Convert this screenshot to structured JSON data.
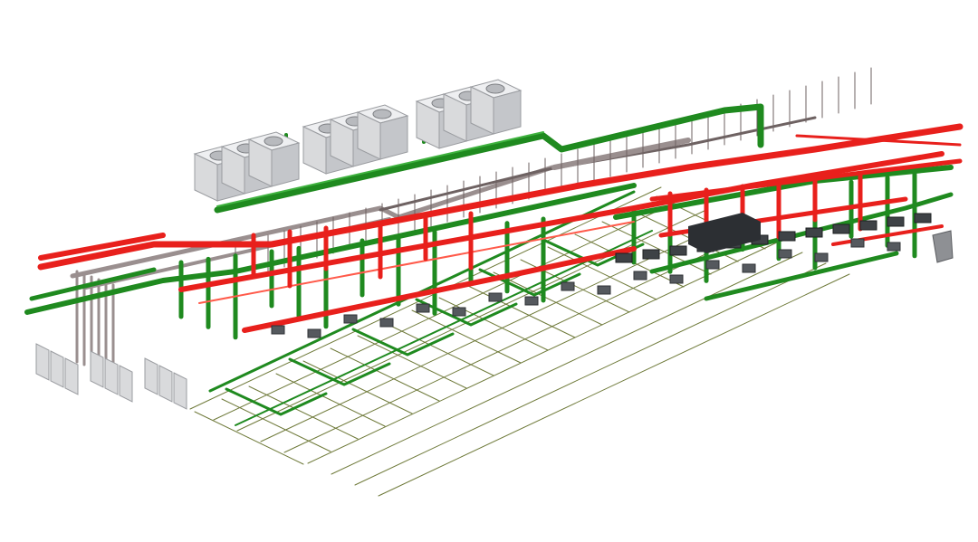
{
  "scene": {
    "kind": "isometric MEP piping model",
    "background_color": "#ffffff",
    "colors": {
      "chilled_water": "#1f8a1f",
      "chilled_water_light": "#3fb23f",
      "hot_water": "#e8201c",
      "hot_water_light": "#ff5a4a",
      "support": "#9a8f8f",
      "support_dark": "#6e6262",
      "equipment": "#d9dadc",
      "equipment_dark": "#9a9ca0",
      "floor_grid": "#6f7a3a"
    },
    "cooling_tower_groups": 3,
    "towers_per_group": 3,
    "chiller_units": 12,
    "pump_units": 18
  }
}
